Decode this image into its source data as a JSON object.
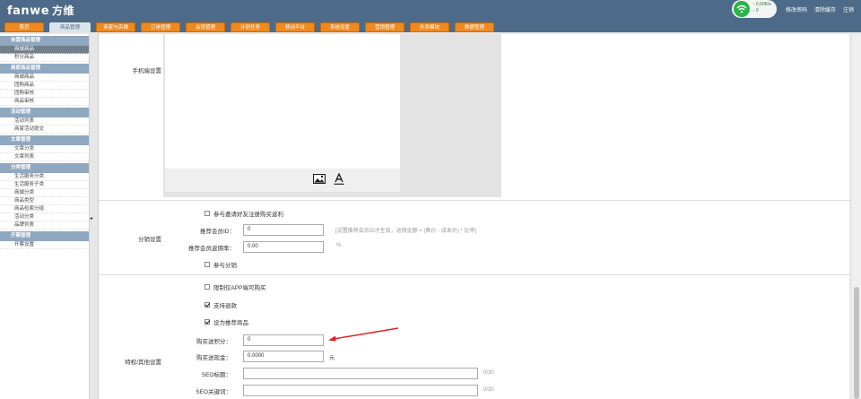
{
  "brand": {
    "name": "fanwe",
    "name_cn": "方维"
  },
  "nav": {
    "tabs": [
      "首页",
      "商品管理",
      "商家与店铺",
      "订单管理",
      "会员管理",
      "计划任务",
      "移动平台",
      "系统设置",
      "营销管理",
      "外卖模块",
      "数据管理"
    ],
    "active_index": 1
  },
  "network": {
    "up": "0.00K/s",
    "down": "0"
  },
  "top_links": {
    "change_password": "修改密码",
    "clear_cache": "清除缓存",
    "logout": "注销"
  },
  "sidebar": {
    "groups": [
      {
        "title": "自营商品管理",
        "items": [
          "商城商品",
          "积分商品"
        ]
      },
      {
        "title": "商家商品管理",
        "items": [
          "商城商品",
          "团购商品",
          "团购审核",
          "商品审核"
        ]
      },
      {
        "title": "活动管理",
        "items": [
          "活动列表",
          "商家活动提交"
        ]
      },
      {
        "title": "文章管理",
        "items": [
          "文章分类",
          "文章列表"
        ]
      },
      {
        "title": "分类管理",
        "items": [
          "生活服务分类",
          "生活服务子类",
          "商城分类",
          "商品类型",
          "商品检索分组",
          "活动分类",
          "品牌列表"
        ]
      },
      {
        "title": "开票管理",
        "items": [
          "开票设置"
        ]
      }
    ],
    "active_item": "商城商品"
  },
  "sections": {
    "mobile": {
      "label": "手机端设置"
    },
    "distribution": {
      "label": "分销设置",
      "invite_checkbox": "参与邀请好友注册购买返利",
      "referrer_id_label": "推荐会员ID：",
      "referrer_id_value": "0",
      "referrer_hint": "[设置推荐会员ID才生效，返佣金额 = (售价 - 成本价) * 比率]",
      "commission_label": "推荐会员返佣率：",
      "commission_value": "0.00",
      "commission_unit": "%",
      "join_checkbox": "参与分销"
    },
    "privileges": {
      "label": "特权/其他设置",
      "app_only": "限制仅APP端可购买",
      "app_only_checked": false,
      "refund": "支持退款",
      "refund_checked": true,
      "recommend": "设为推荐商品",
      "recommend_checked": true,
      "points_label": "购买送积分：",
      "points_value": "0",
      "cash_label": "购买送现金：",
      "cash_value": "0.0000",
      "cash_unit": "元",
      "seo_title_label": "SEO标题：",
      "seo_title_count": "0/30",
      "seo_keywords_label": "SEO关键词：",
      "seo_keywords_count": "0/30"
    }
  }
}
